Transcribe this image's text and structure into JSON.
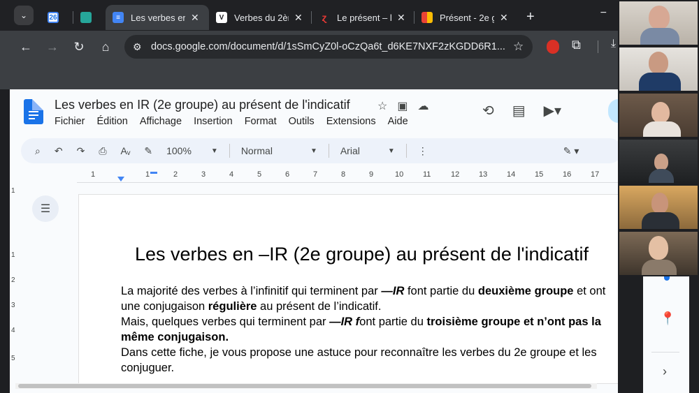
{
  "browser": {
    "tabs": [
      {
        "title": "",
        "favicon": "calendar-icon",
        "color": "#4285f4",
        "glyph": "26"
      },
      {
        "title": "",
        "favicon": "trello-icon",
        "color": "#26a69a",
        "glyph": ""
      },
      {
        "title": "Les verbes en",
        "favicon": "docs-icon",
        "color": "#4285f4",
        "glyph": "≡",
        "active": true
      },
      {
        "title": "Verbes du 2èr",
        "favicon": "v-icon",
        "color": "#ffffff",
        "glyph": "V"
      },
      {
        "title": "Le présent – l",
        "favicon": "ribbon-icon",
        "color": "#202124",
        "glyph": "ɀ"
      },
      {
        "title": "Présent - 2e g",
        "favicon": "colorful-icon",
        "color": "#f4b400",
        "glyph": ""
      }
    ],
    "new_tab": "+",
    "minimize": "−",
    "url": "docs.google.com/document/d/1sSmCyZ0l-oCzQa6t_d6KE7NXF2zKGDD6R1..."
  },
  "docs": {
    "title": "Les verbes en IR (2e groupe) au présent de l'indicatif",
    "menu": [
      "Fichier",
      "Édition",
      "Affichage",
      "Insertion",
      "Format",
      "Outils",
      "Extensions",
      "Aide"
    ],
    "toolbar": {
      "zoom": "100%",
      "style": "Normal",
      "font": "Arial"
    },
    "ruler_numbers": [
      "1",
      "1",
      "2",
      "3",
      "4",
      "5",
      "6",
      "7",
      "8",
      "9",
      "10",
      "11",
      "12",
      "13",
      "14",
      "15",
      "16",
      "17"
    ],
    "vruler_numbers": [
      "1",
      "1",
      "2",
      "3",
      "4",
      "5"
    ]
  },
  "document": {
    "heading": "Les verbes en –IR (2e groupe) au présent de l'indicatif",
    "line1_a": "La majorité des verbes à l’infinitif qui terminent par ",
    "line1_b": "—IR",
    "line1_c": " font partie du ",
    "line1_d": "deuxième groupe",
    "line1_e": " et ont",
    "line2_a": "une conjugaison ",
    "line2_b": "régulière",
    "line2_c": " au présent de l’indicatif.",
    "line3_a": "Mais, quelques verbes qui terminent par  ",
    "line3_b": "—IR f",
    "line3_c": "ont partie du ",
    "line3_d": "troisième groupe et n’ont pas la",
    "line4": "même conjugaison.",
    "line5": "Dans cette fiche, je vous propose une astuce pour reconnaître les verbes du 2e groupe et les",
    "line6": "conjuguer."
  }
}
